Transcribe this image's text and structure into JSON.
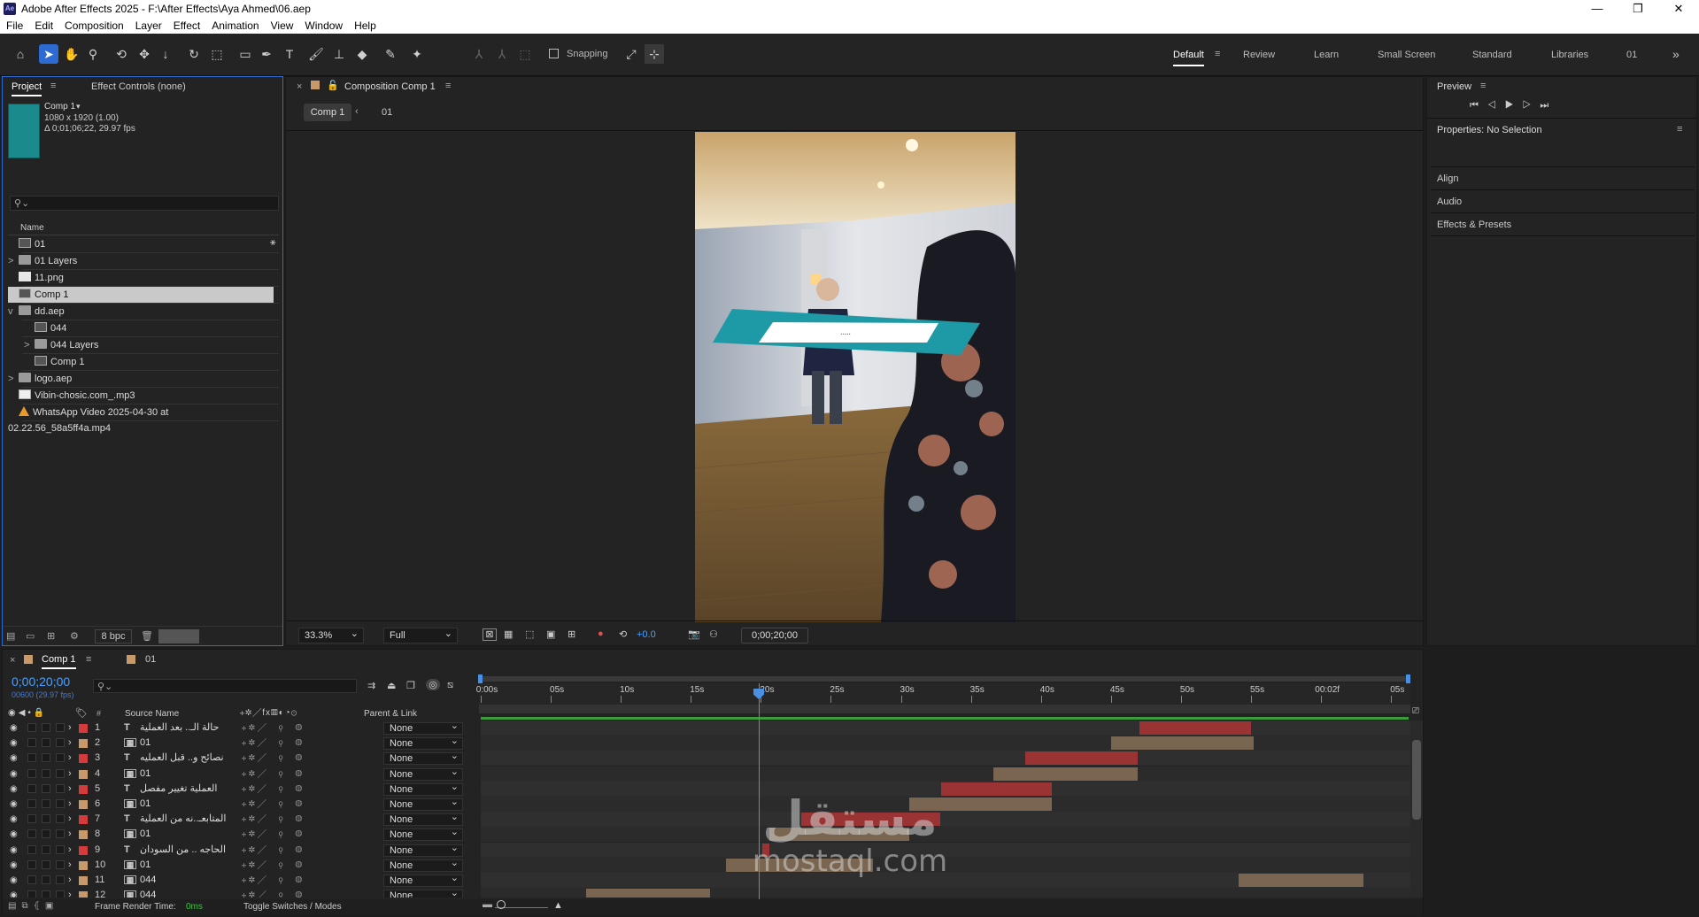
{
  "app": {
    "title": "Adobe After Effects 2025 - F:\\After Effects\\Aya Ahmed\\06.aep",
    "logo": "Ae"
  },
  "menu": [
    "File",
    "Edit",
    "Composition",
    "Layer",
    "Effect",
    "Animation",
    "View",
    "Window",
    "Help"
  ],
  "toolbar": {
    "snapping_label": "Snapping",
    "workspaces": [
      "Default",
      "Review",
      "Learn",
      "Small Screen",
      "Standard",
      "Libraries",
      "01"
    ],
    "active_workspace": "Default"
  },
  "project": {
    "tab_project": "Project",
    "tab_effects": "Effect Controls (none)",
    "selected_name": "Comp 1",
    "selected_info1": "1080 x 1920 (1.00)",
    "selected_info2": "Δ 0;01;06;22, 29.97 fps",
    "column_name": "Name",
    "items": [
      {
        "name": "01",
        "type": "comp",
        "indent": 0,
        "twirl": ""
      },
      {
        "name": "01 Layers",
        "type": "folder",
        "indent": 0,
        "twirl": ">"
      },
      {
        "name": "11.png",
        "type": "file",
        "indent": 0,
        "twirl": ""
      },
      {
        "name": "Comp 1",
        "type": "comp",
        "indent": 0,
        "twirl": "",
        "selected": true
      },
      {
        "name": "dd.aep",
        "type": "folder",
        "indent": 0,
        "twirl": "v"
      },
      {
        "name": "044",
        "type": "comp",
        "indent": 1,
        "twirl": ""
      },
      {
        "name": "044 Layers",
        "type": "folder",
        "indent": 1,
        "twirl": ">"
      },
      {
        "name": "Comp 1",
        "type": "comp",
        "indent": 1,
        "twirl": ""
      },
      {
        "name": "logo.aep",
        "type": "folder",
        "indent": 0,
        "twirl": ">"
      },
      {
        "name": "Vibin-chosic.com_.mp3",
        "type": "audio",
        "indent": 0,
        "twirl": ""
      },
      {
        "name": "WhatsApp Video 2025-04-30 at 02.22.56_58a5ff4a.mp4",
        "type": "warn",
        "indent": 0,
        "twirl": ""
      }
    ],
    "bpc": "8 bpc"
  },
  "composition": {
    "panel_title": "Composition Comp 1",
    "breadcrumb": [
      "Comp 1",
      "01"
    ],
    "zoom": "33.3%",
    "resolution": "Full",
    "exposure": "+0.0",
    "timecode": "0;00;20;00"
  },
  "right": {
    "preview_title": "Preview",
    "properties_title": "Properties: No Selection",
    "sections": [
      "Align",
      "Audio",
      "Effects & Presets"
    ]
  },
  "timeline": {
    "tabs": [
      "Comp 1",
      "01"
    ],
    "timecode": "0;00;20;00",
    "fps": "00600 (29.97 fps)",
    "col_source": "Source Name",
    "col_parent": "Parent & Link",
    "ruler": [
      "0:00s",
      "05s",
      "10s",
      "15s",
      "20s",
      "25s",
      "30s",
      "35s",
      "40s",
      "45s",
      "50s",
      "55s",
      "00:02f",
      "05s"
    ],
    "layers": [
      {
        "num": "1",
        "type": "T",
        "name": "حالة الـ.. بعد العملية",
        "color": "#d23c3c",
        "parent": "None",
        "bar": {
          "start": 47,
          "end": 55,
          "color": "#9a3434"
        }
      },
      {
        "num": "2",
        "type": "comp",
        "name": "01",
        "color": "#c89a6a",
        "parent": "None",
        "bar": {
          "start": 45,
          "end": 55.2,
          "color": "#7a6650"
        }
      },
      {
        "num": "3",
        "type": "T",
        "name": "نصائح و.. قبل العمليه",
        "color": "#d23c3c",
        "parent": "None",
        "bar": {
          "start": 38.9,
          "end": 46.9,
          "color": "#9a3434"
        }
      },
      {
        "num": "4",
        "type": "comp",
        "name": "01",
        "color": "#c89a6a",
        "parent": "None",
        "bar": {
          "start": 36.6,
          "end": 46.9,
          "color": "#7a6650"
        }
      },
      {
        "num": "5",
        "type": "T",
        "name": "العملية تغيير مفصل",
        "color": "#d23c3c",
        "parent": "None",
        "bar": {
          "start": 32.9,
          "end": 40.8,
          "color": "#9a3434"
        }
      },
      {
        "num": "6",
        "type": "comp",
        "name": "01",
        "color": "#c89a6a",
        "parent": "None",
        "bar": {
          "start": 30.6,
          "end": 40.8,
          "color": "#7a6650"
        }
      },
      {
        "num": "7",
        "type": "T",
        "name": "المتابعـ..نه من العملية",
        "color": "#d23c3c",
        "parent": "None",
        "bar": {
          "start": 22.9,
          "end": 32.8,
          "color": "#9a3434"
        }
      },
      {
        "num": "8",
        "type": "comp",
        "name": "01",
        "color": "#c89a6a",
        "parent": "None",
        "bar": {
          "start": 20.6,
          "end": 30.6,
          "color": "#7a6650"
        }
      },
      {
        "num": "9",
        "type": "T",
        "name": "الحاجه .. من السودان",
        "color": "#d23c3c",
        "parent": "None",
        "bar": {
          "start": 20.1,
          "end": 20.6,
          "color": "#9a3434"
        }
      },
      {
        "num": "10",
        "type": "comp",
        "name": "01",
        "color": "#c89a6a",
        "parent": "None",
        "bar": {
          "start": 17.5,
          "end": 28,
          "color": "#7a6650"
        }
      },
      {
        "num": "11",
        "type": "comp",
        "name": "044",
        "color": "#c89a6a",
        "parent": "None",
        "bar": {
          "start": 54.1,
          "end": 63,
          "color": "#7a6650"
        }
      },
      {
        "num": "12",
        "type": "comp",
        "name": "044",
        "color": "#c89a6a",
        "parent": "None",
        "bar": {
          "start": 7.5,
          "end": 16.4,
          "color": "#7a6650"
        }
      }
    ],
    "frame_render_label": "Frame Render Time:",
    "frame_render_value": "0ms",
    "toggle_label": "Toggle Switches / Modes"
  },
  "watermark": {
    "arabic": "مستقل",
    "latin": "mostaql.com"
  },
  "colors": {
    "accent": "#2d8ceb",
    "playhead": "#4a90e2",
    "workarea": "#3c9c3c"
  }
}
